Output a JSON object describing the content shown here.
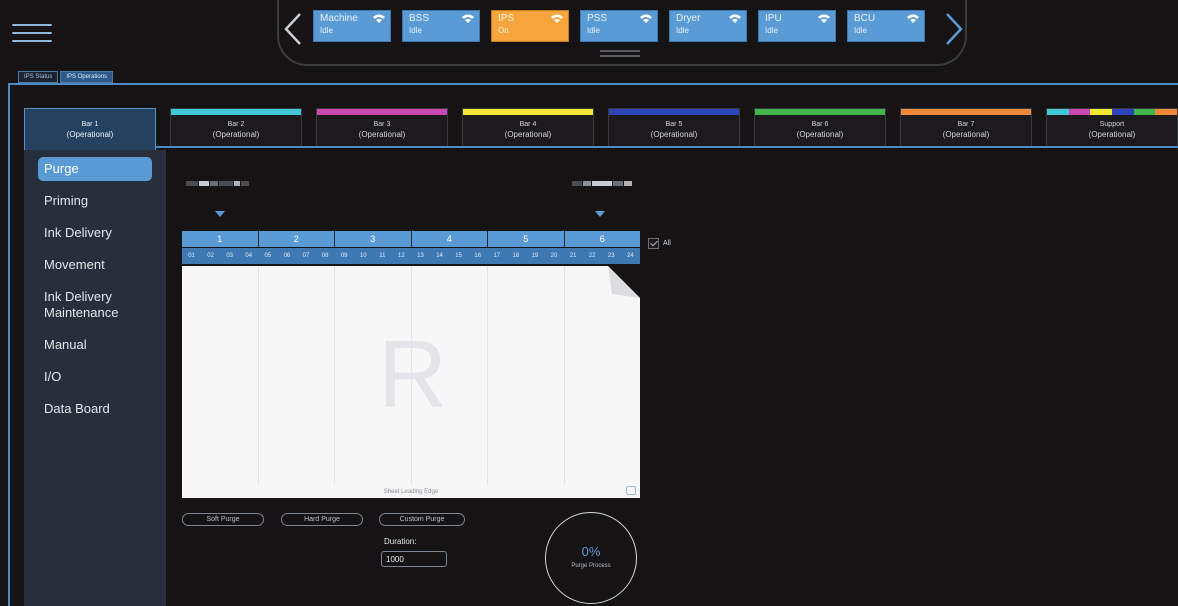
{
  "header": {
    "status_tiles": [
      {
        "name": "Machine",
        "state": "Idle",
        "active": false
      },
      {
        "name": "BSS",
        "state": "Idle",
        "active": false
      },
      {
        "name": "IPS",
        "state": "On",
        "active": true
      },
      {
        "name": "PSS",
        "state": "Idle",
        "active": false
      },
      {
        "name": "Dryer",
        "state": "Idle",
        "active": false
      },
      {
        "name": "IPU",
        "state": "Idle",
        "active": false
      },
      {
        "name": "BCU",
        "state": "Idle",
        "active": false
      }
    ],
    "icons": {
      "menu": "hamburger-icon",
      "prev": "chevron-left-icon",
      "next": "chevron-right-icon",
      "wifi": "wifi-icon"
    }
  },
  "page_tabs": [
    {
      "label": "IPS Status",
      "active": false
    },
    {
      "label": "IPS Operations",
      "active": true
    }
  ],
  "bar_tabs": [
    {
      "name": "Bar 1",
      "state": "(Operational)",
      "color": "",
      "active": true
    },
    {
      "name": "Bar 2",
      "state": "(Operational)",
      "color": "#3ec8d8",
      "active": false
    },
    {
      "name": "Bar 3",
      "state": "(Operational)",
      "color": "#c848b4",
      "active": false
    },
    {
      "name": "Bar 4",
      "state": "(Operational)",
      "color": "#f2e832",
      "active": false
    },
    {
      "name": "Bar 5",
      "state": "(Operational)",
      "color": "#2c44b8",
      "active": false
    },
    {
      "name": "Bar 6",
      "state": "(Operational)",
      "color": "#3fb54a",
      "active": false
    },
    {
      "name": "Bar 7",
      "state": "(Operational)",
      "color": "#f08a3a",
      "active": false
    },
    {
      "name": "Support",
      "state": "(Operational)",
      "color": "multi",
      "active": false
    }
  ],
  "support_colors": [
    "#3ec8d8",
    "#c848b4",
    "#f2e832",
    "#2c44b8",
    "#3fb54a",
    "#f08a3a"
  ],
  "sidebar": {
    "items": [
      {
        "label": "Purge",
        "active": true
      },
      {
        "label": "Priming",
        "active": false
      },
      {
        "label": "Ink Delivery",
        "active": false
      },
      {
        "label": "Movement",
        "active": false
      },
      {
        "label": "Ink Delivery Maintenance",
        "active": false
      },
      {
        "label": "Manual",
        "active": false
      },
      {
        "label": "I/O",
        "active": false
      },
      {
        "label": "Data Board",
        "active": false
      }
    ]
  },
  "purge": {
    "head_groups": [
      "1",
      "2",
      "3",
      "4",
      "5",
      "6"
    ],
    "nozzles": [
      "01",
      "02",
      "03",
      "04",
      "05",
      "06",
      "07",
      "08",
      "09",
      "10",
      "11",
      "12",
      "13",
      "14",
      "15",
      "16",
      "17",
      "18",
      "19",
      "20",
      "21",
      "22",
      "23",
      "24"
    ],
    "all_label": "All",
    "sheet_letter": "R",
    "sheet_caption": "Sheet Leading Edge",
    "buttons": {
      "soft": "Soft Purge",
      "hard": "Hard Purge",
      "custom": "Custom Purge"
    },
    "duration_label": "Duration:",
    "duration_value": "1000",
    "progress_value": "0%",
    "progress_label": "Purge Process"
  },
  "colors": {
    "accent": "#5b9bd5",
    "active_tile": "#f5a53b",
    "background": "#161314",
    "sidebar": "#262f3b"
  }
}
